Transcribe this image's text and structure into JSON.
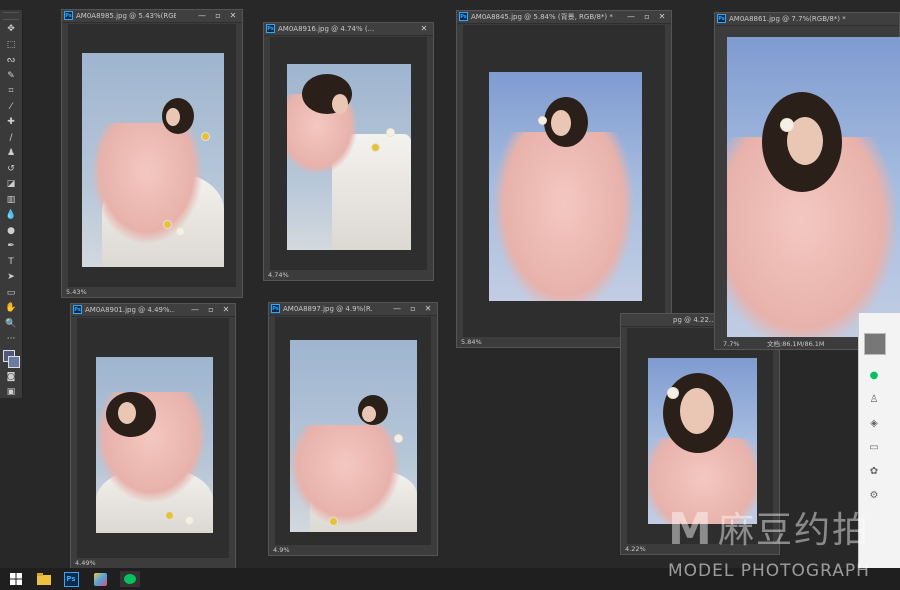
{
  "app": {
    "name": "Photoshop"
  },
  "documents": [
    {
      "title": "AM0A8985.jpg @ 5.43%(RGB/...",
      "zoom": "5.43%"
    },
    {
      "title": "AM0A8916.jpg @ 4.74% (...",
      "zoom": "4.74%"
    },
    {
      "title": "AM0A8845.jpg @ 5.84% (背景, RGB/8*) *",
      "zoom": "5.84%"
    },
    {
      "title": "AM0A8861.jpg @ 7.7%(RGB/8*) *",
      "zoom": "7.7%",
      "doc_info": "文档:86.1M/86.1M"
    },
    {
      "title": "AM0A8901.jpg @ 4.49%...",
      "zoom": "4.49%"
    },
    {
      "title": "AM0A8897.jpg @ 4.9%(R...",
      "zoom": "4.9%"
    },
    {
      "title": "pg @ 4.22...",
      "zoom": "4.22%"
    }
  ],
  "window_controls": {
    "minimize": "—",
    "maximize": "▫",
    "close": "✕"
  },
  "tools": [
    "move",
    "marquee",
    "lasso",
    "quick-select",
    "crop",
    "eyedropper",
    "healing",
    "brush",
    "stamp",
    "history-brush",
    "eraser",
    "gradient",
    "blur",
    "dodge",
    "pen",
    "type",
    "path-select",
    "shape",
    "hand",
    "zoom",
    "more"
  ],
  "taskbar": {
    "items": [
      "windows-start-icon",
      "file-explorer-icon",
      "photoshop-icon",
      "gallery-app-icon",
      "wechat-icon"
    ]
  },
  "side_panel": {
    "icons": [
      "avatar",
      "chat-icon",
      "contacts-icon",
      "box-icon",
      "folder-icon",
      "moments-icon",
      "settings-icon"
    ]
  },
  "watermark": {
    "logo": "M",
    "cn": "麻豆约拍",
    "en": "MODEL PHOTOGRAPH"
  },
  "colors": {
    "ps_blue": "#31a8ff",
    "ui_dark": "#282828",
    "panel": "#3c3c3c"
  }
}
